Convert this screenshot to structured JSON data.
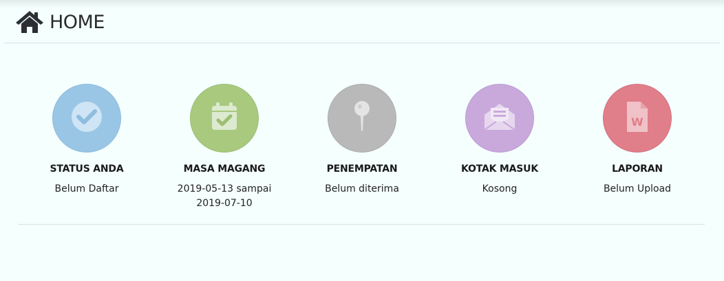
{
  "header": {
    "title": "HOME",
    "icon": "home-icon"
  },
  "colors": {
    "background": "#f4fffe",
    "status": "#9ac6e6",
    "masa": "#a9c97e",
    "penempatan": "#b9b9b9",
    "kotak": "#c9a9dc",
    "laporan": "#e07e8a"
  },
  "cards": [
    {
      "title": "STATUS ANDA",
      "value": "Belum Daftar",
      "icon": "check-circle-icon"
    },
    {
      "title": "MASA MAGANG",
      "value": "2019-05-13 sampai 2019-07-10",
      "icon": "calendar-check-icon"
    },
    {
      "title": "PENEMPATAN",
      "value": "Belum diterima",
      "icon": "map-pin-icon"
    },
    {
      "title": "KOTAK MASUK",
      "value": "Kosong",
      "icon": "envelope-open-icon"
    },
    {
      "title": "LAPORAN",
      "value": "Belum Upload",
      "icon": "word-file-icon"
    }
  ]
}
